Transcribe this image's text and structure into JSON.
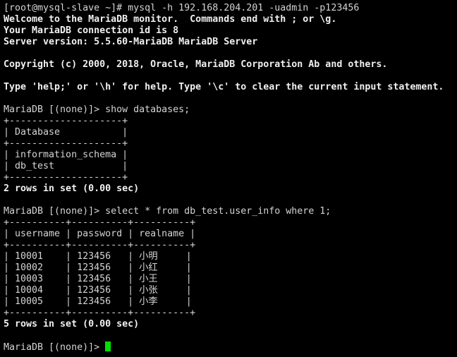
{
  "terminal": {
    "cursor_color": "#00e000",
    "lines": [
      {
        "text": "[root@mysql-slave ~]# mysql -h 192.168.204.201 -uadmin -p123456",
        "bold": false
      },
      {
        "text": "Welcome to the MariaDB monitor.  Commands end with ; or \\g.",
        "bold": true
      },
      {
        "text": "Your MariaDB connection id is 8",
        "bold": true
      },
      {
        "text": "Server version: 5.5.60-MariaDB MariaDB Server",
        "bold": true
      },
      {
        "text": "",
        "bold": false
      },
      {
        "text": "Copyright (c) 2000, 2018, Oracle, MariaDB Corporation Ab and others.",
        "bold": true
      },
      {
        "text": "",
        "bold": false
      },
      {
        "text": "Type 'help;' or '\\h' for help. Type '\\c' to clear the current input statement.",
        "bold": true
      },
      {
        "text": "",
        "bold": false
      },
      {
        "text": "MariaDB [(none)]> show databases;",
        "bold": false
      },
      {
        "text": "+--------------------+",
        "bold": false
      },
      {
        "text": "| Database           |",
        "bold": false
      },
      {
        "text": "+--------------------+",
        "bold": false
      },
      {
        "text": "| information_schema |",
        "bold": false
      },
      {
        "text": "| db_test            |",
        "bold": false
      },
      {
        "text": "+--------------------+",
        "bold": false
      },
      {
        "text": "2 rows in set (0.00 sec)",
        "bold": true
      },
      {
        "text": "",
        "bold": false
      },
      {
        "text": "MariaDB [(none)]> select * from db_test.user_info where 1;",
        "bold": false
      },
      {
        "text": "+----------+----------+----------+",
        "bold": false
      },
      {
        "text": "| username | password | realname |",
        "bold": false
      },
      {
        "text": "+----------+----------+----------+",
        "bold": false
      },
      {
        "text": "| 10001    | 123456   | 小明     |",
        "bold": false
      },
      {
        "text": "| 10002    | 123456   | 小红     |",
        "bold": false
      },
      {
        "text": "| 10003    | 123456   | 小王     |",
        "bold": false
      },
      {
        "text": "| 10004    | 123456   | 小张     |",
        "bold": false
      },
      {
        "text": "| 10005    | 123456   | 小李     |",
        "bold": false
      },
      {
        "text": "+----------+----------+----------+",
        "bold": false
      },
      {
        "text": "5 rows in set (0.00 sec)",
        "bold": true
      },
      {
        "text": "",
        "bold": false
      },
      {
        "text": "MariaDB [(none)]> ",
        "bold": false,
        "cursor": true
      }
    ]
  }
}
